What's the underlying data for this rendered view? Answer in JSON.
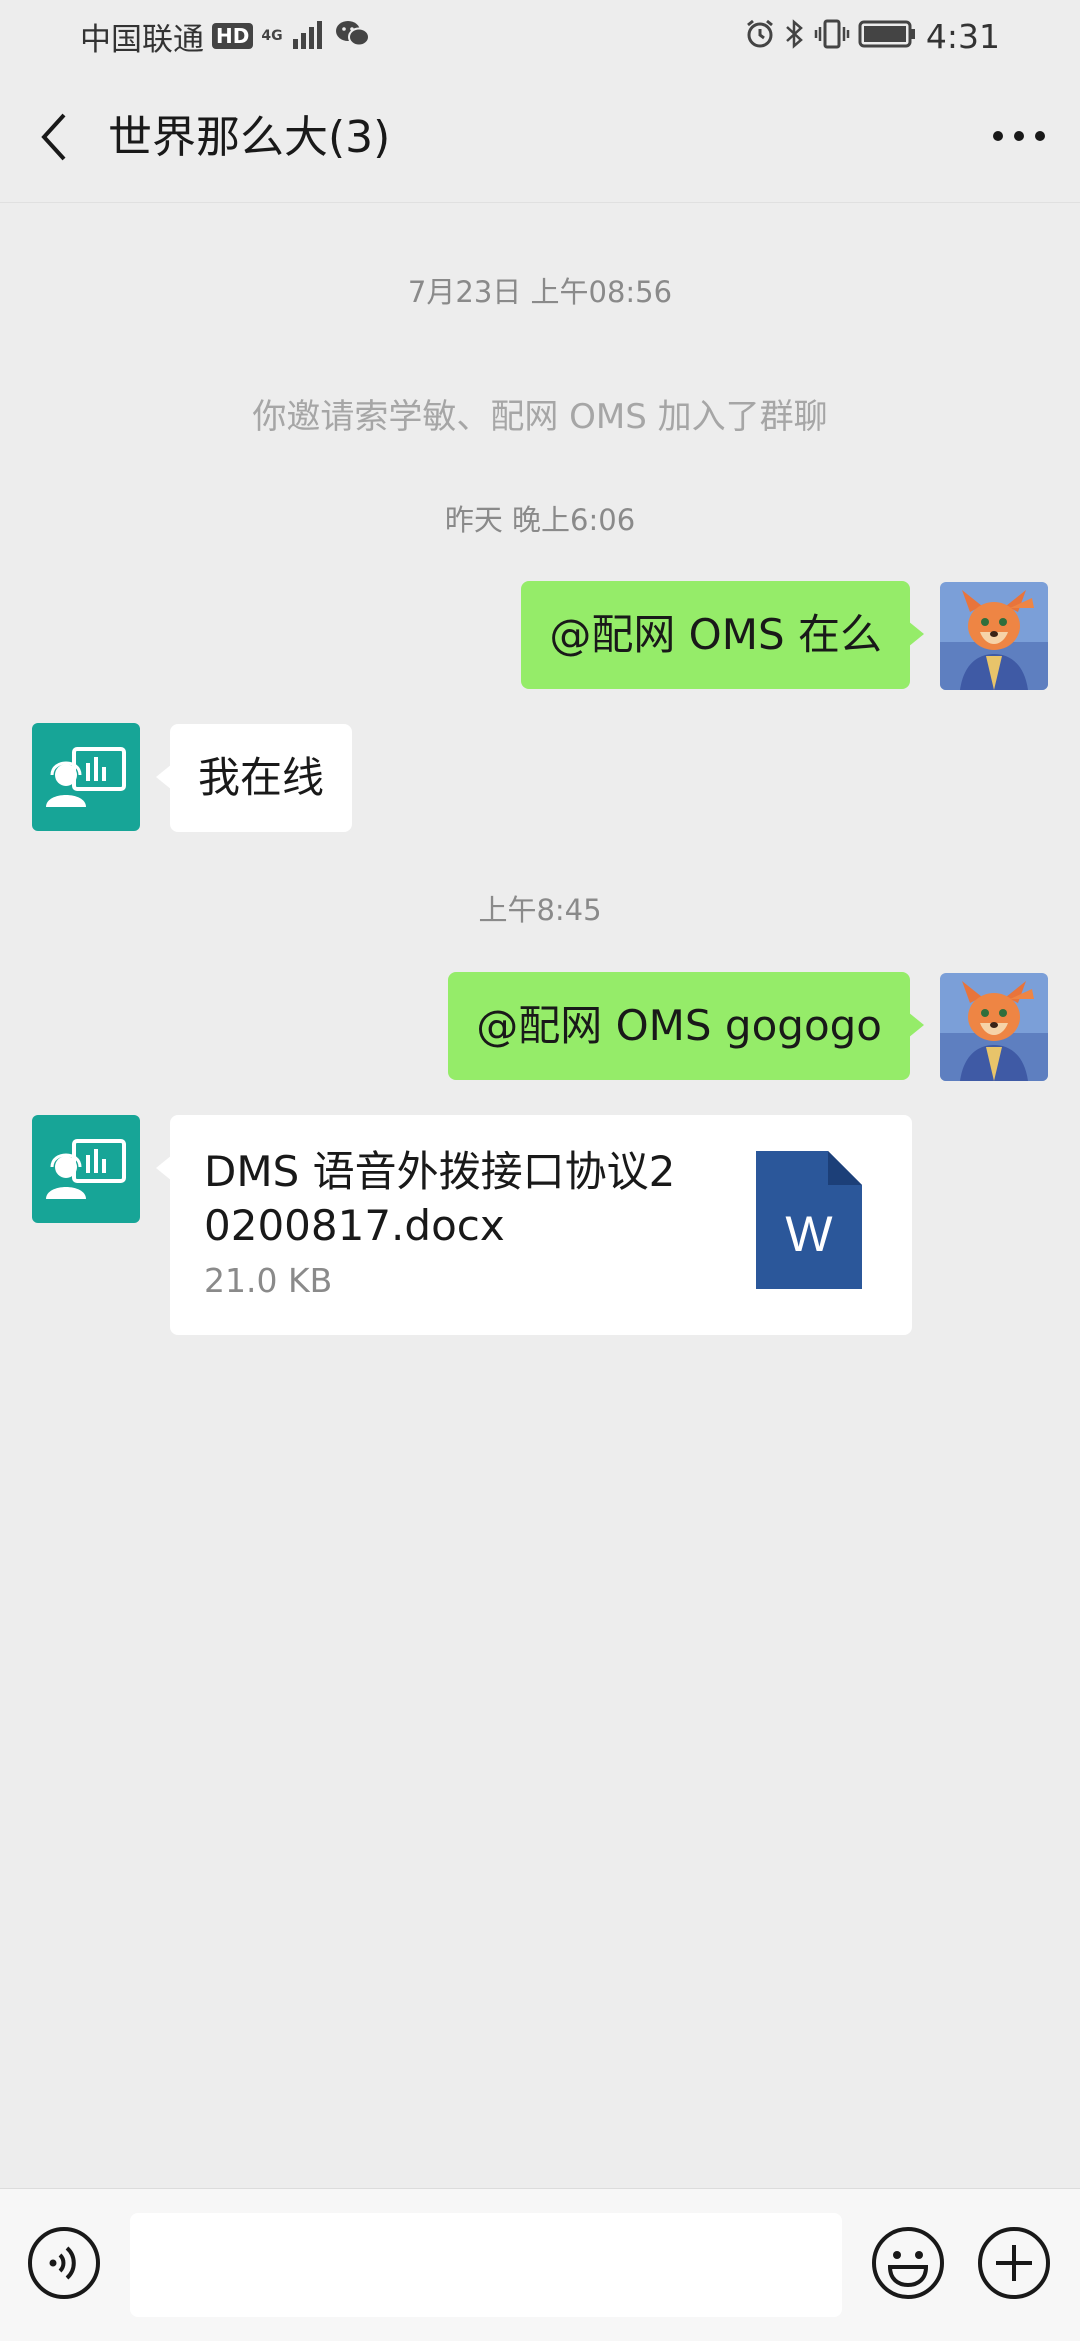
{
  "status_bar": {
    "carrier": "中国联通",
    "hd_badge": "HD",
    "network": "4G",
    "time": "4:31"
  },
  "header": {
    "title": "世界那么大(3)"
  },
  "messages": {
    "timestamp_1": "7月23日 上午08:56",
    "system_notice": "你邀请索学敏、配网 OMS 加入了群聊",
    "timestamp_2": "昨天 晚上6:06",
    "msg_1": "@配网 OMS  在么",
    "msg_2": "我在线",
    "timestamp_3": "上午8:45",
    "msg_3": "@配网 OMS gogogo",
    "file": {
      "name": "DMS 语音外拨接口协议20200817.docx",
      "size": "21.0 KB",
      "icon_letter": "W"
    }
  },
  "colors": {
    "background": "#ededed",
    "my_bubble": "#95ec69",
    "their_bubble": "#ffffff",
    "bot_avatar": "#17a597",
    "word_icon": "#2b579a"
  },
  "input_bar": {
    "placeholder": "",
    "voice_icon": "voice-icon",
    "emoji_icon": "emoji-icon",
    "plus_icon": "plus-icon"
  }
}
